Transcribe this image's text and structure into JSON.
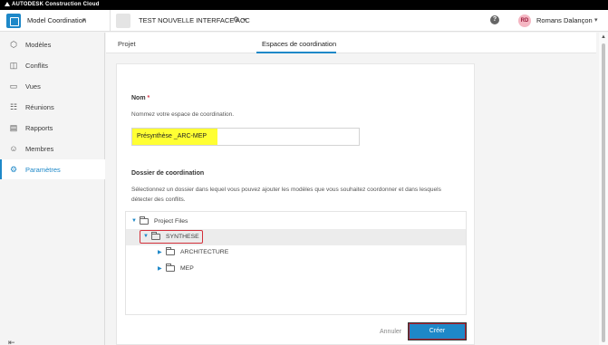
{
  "brand": "AUTODESK Construction Cloud",
  "topbar": {
    "app_name": "Model Coordination",
    "project_name": "TEST NOUVELLE INTERFACE ACC",
    "help": "?",
    "user_initials": "RD",
    "user_name": "Romans Dalançon"
  },
  "sidebar": {
    "items": [
      {
        "label": "Modèles",
        "icon": "cube-icon"
      },
      {
        "label": "Conflits",
        "icon": "clash-icon"
      },
      {
        "label": "Vues",
        "icon": "views-icon"
      },
      {
        "label": "Réunions",
        "icon": "meeting-icon"
      },
      {
        "label": "Rapports",
        "icon": "report-icon"
      },
      {
        "label": "Membres",
        "icon": "members-icon"
      },
      {
        "label": "Paramètres",
        "icon": "gear-icon",
        "active": true
      }
    ]
  },
  "tabs": [
    {
      "label": "Projet"
    },
    {
      "label": "Espaces de coordination",
      "active": true
    }
  ],
  "form": {
    "name_label": "Nom",
    "required_mark": "*",
    "name_help": "Nommez votre espace de coordination.",
    "name_value": "Présynthèse _ARC-MEP",
    "folder_label": "Dossier de coordination",
    "folder_help": "Sélectionnez un dossier dans lequel vous pouvez ajouter les modèles que vous souhaitez coordonner et dans lesquels détecter des conflits.",
    "tree": {
      "root": "Project Files",
      "selected": "SYNTHESE",
      "children": [
        "ARCHITECTURE",
        "MEP"
      ]
    },
    "cancel_label": "Annuler",
    "create_label": "Créer"
  },
  "colors": {
    "accent": "#1e88c8",
    "highlight": "#ffff33",
    "annotation_red": "#d32f3a"
  }
}
